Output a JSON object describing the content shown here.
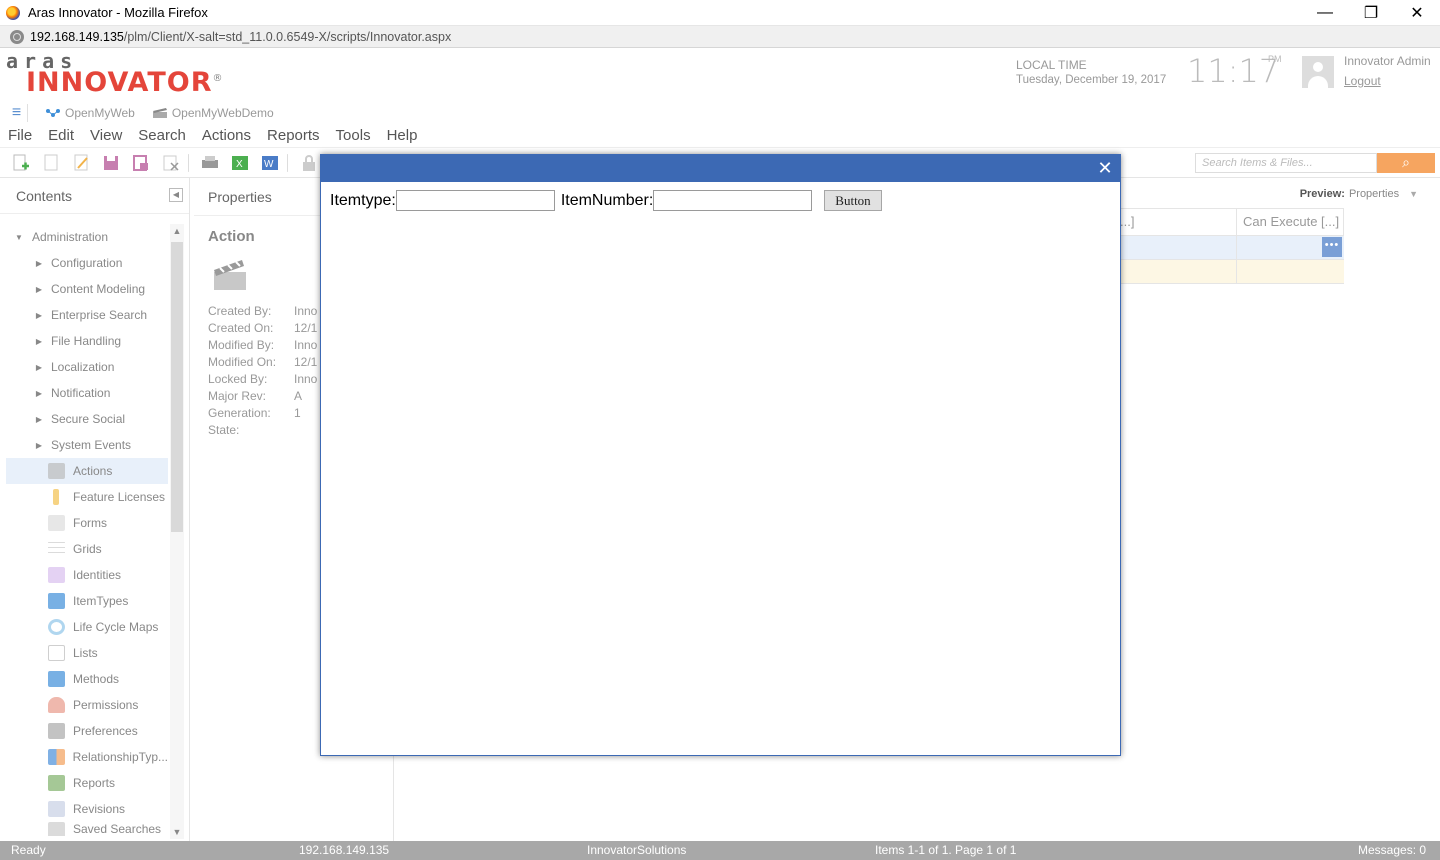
{
  "window": {
    "title": "Aras Innovator - Mozilla Firefox",
    "controls": {
      "minimize": "—",
      "maximize": "❐",
      "close": "✕"
    }
  },
  "urlbar": {
    "host": "192.168.149.135",
    "path": "/plm/Client/X-salt=std_11.0.0.6549-X/scripts/Innovator.aspx"
  },
  "header": {
    "logo_top": "aras",
    "logo_main": "INNOVATOR",
    "logo_mark": "®",
    "local_time_label": "LOCAL TIME",
    "local_date": "Tuesday, December 19, 2017",
    "clock": "11:17",
    "ampm": "PM",
    "user_name": "Innovator Admin",
    "logout": "Logout"
  },
  "tabs": [
    {
      "label": "OpenMyWeb",
      "icon": "methods-icon"
    },
    {
      "label": "OpenMyWebDemo",
      "icon": "action-icon"
    }
  ],
  "menu": [
    "File",
    "Edit",
    "View",
    "Search",
    "Actions",
    "Reports",
    "Tools",
    "Help"
  ],
  "toolbar": {
    "search_placeholder": "Search Items & Files...",
    "search_icon": "⌕"
  },
  "contents": {
    "title": "Contents",
    "root": "Administration",
    "folders": [
      "Configuration",
      "Content Modeling",
      "Enterprise Search",
      "File Handling",
      "Localization",
      "Notification",
      "Secure Social",
      "System Events"
    ],
    "items": [
      {
        "label": "Actions",
        "icon": "action-icon",
        "color": "#bbbbbb"
      },
      {
        "label": "Feature Licenses",
        "icon": "key-icon",
        "color": "#f2c14e"
      },
      {
        "label": "Forms",
        "icon": "form-icon",
        "color": "#cccccc"
      },
      {
        "label": "Grids",
        "icon": "grid-icon",
        "color": "#cccccc"
      },
      {
        "label": "Identities",
        "icon": "identity-icon",
        "color": "#b48ad6"
      },
      {
        "label": "ItemTypes",
        "icon": "itemtype-icon",
        "color": "#3f8fd8"
      },
      {
        "label": "Life Cycle Maps",
        "icon": "lifecycle-icon",
        "color": "#8ec4e8"
      },
      {
        "label": "Lists",
        "icon": "list-icon",
        "color": "#cccccc"
      },
      {
        "label": "Methods",
        "icon": "methods-icon",
        "color": "#3f8fd8"
      },
      {
        "label": "Permissions",
        "icon": "permission-icon",
        "color": "#e89a8a"
      },
      {
        "label": "Preferences",
        "icon": "preferences-icon",
        "color": "#aaaaaa"
      },
      {
        "label": "RelationshipTyp...",
        "icon": "relationship-icon",
        "color": "#4a8fd8"
      },
      {
        "label": "Reports",
        "icon": "report-icon",
        "color": "#7fb06a"
      },
      {
        "label": "Revisions",
        "icon": "revision-icon",
        "color": "#9aa8c8"
      },
      {
        "label": "Saved Searches",
        "icon": "saved-search-icon",
        "color": "#bbbbbb"
      }
    ],
    "selected": "Actions"
  },
  "properties": {
    "title": "Properties",
    "item_type": "Action",
    "fields": [
      {
        "key": "Created By:",
        "value": "Inno"
      },
      {
        "key": "Created On:",
        "value": "12/1"
      },
      {
        "key": "Modified By:",
        "value": "Inno"
      },
      {
        "key": "Modified On:",
        "value": "12/1"
      },
      {
        "key": "Locked By:",
        "value": "Inno"
      },
      {
        "key": "Major Rev:",
        "value": "A"
      },
      {
        "key": "Generation:",
        "value": "1"
      },
      {
        "key": "State:",
        "value": ""
      }
    ]
  },
  "main": {
    "preview_label": "Preview:",
    "preview_value": "Properties",
    "columns": [
      "...]",
      "Can Execute [...]"
    ],
    "more_button": "•••"
  },
  "dialog": {
    "close": "✕",
    "itemtype_label": "Itemtype:",
    "itemtype_value": "",
    "itemnumber_label": "ItemNumber:",
    "itemnumber_value": "",
    "button_label": "Button"
  },
  "status": {
    "state": "Ready",
    "server": "192.168.149.135",
    "database": "InnovatorSolutions",
    "paging": "Items 1-1 of 1. Page 1 of 1",
    "messages": "Messages:  0"
  }
}
